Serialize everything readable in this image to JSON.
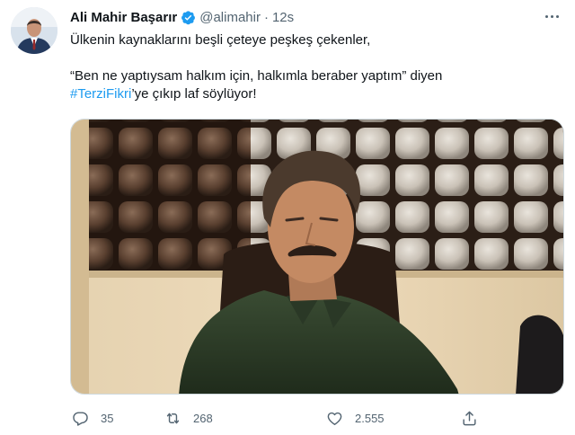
{
  "tweet": {
    "author_name": "Ali Mahir Başarır",
    "handle": "@alimahir",
    "separator": "·",
    "time": "12s",
    "text_line1": "Ülkenin kaynaklarını beşli çeteye peşkeş çekenler,",
    "text_line2": "“Ben ne yaptıysam halkım için, halkımla beraber yaptım” diyen",
    "hashtag": "#TerziFikri",
    "text_line3_rest": "’ye çıkıp laf söylüyor!",
    "media_description": "photo",
    "icons": {
      "verified": "verified-badge-icon",
      "more": "more-options-icon",
      "reply": "reply-icon",
      "retweet": "retweet-icon",
      "like": "like-icon",
      "share": "share-icon"
    }
  },
  "actions": {
    "reply_count": "35",
    "retweet_count": "268",
    "like_count": "2.555"
  },
  "colors": {
    "accent": "#1d9bf0",
    "text": "#0f1419",
    "secondary": "#536471",
    "border": "#cfd9de",
    "shirt": "#2f3f2a"
  }
}
